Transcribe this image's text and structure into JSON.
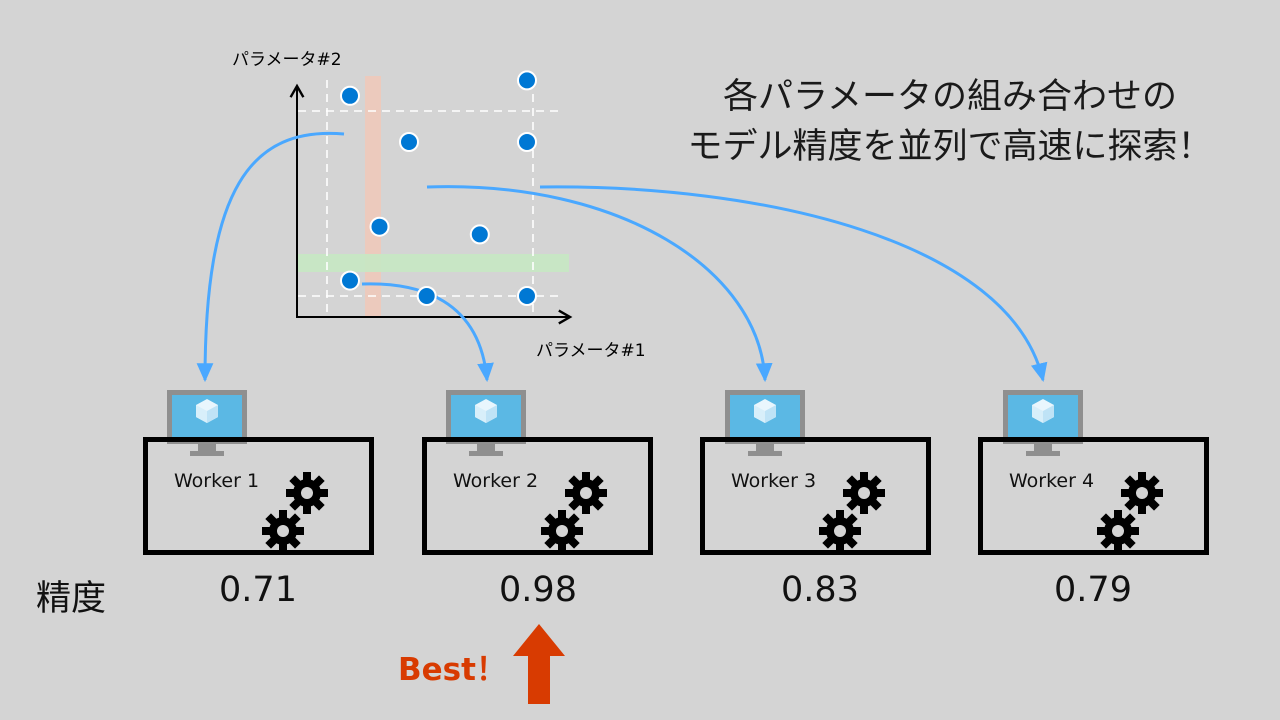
{
  "headline": {
    "line1": "各パラメータの組み合わせの",
    "line2": "モデル精度を並列で高速に探索！"
  },
  "plot": {
    "y_axis_label": "パラメータ#2",
    "x_axis_label": "パラメータ#1",
    "points": [
      {
        "x": 1,
        "y": 5
      },
      {
        "x": 4,
        "y": 5.2
      },
      {
        "x": 2,
        "y": 4.4
      },
      {
        "x": 4,
        "y": 4.4
      },
      {
        "x": 1.5,
        "y": 3.3
      },
      {
        "x": 3.2,
        "y": 3.2
      },
      {
        "x": 1,
        "y": 2.6
      },
      {
        "x": 2.3,
        "y": 2.4
      },
      {
        "x": 4,
        "y": 2.4
      }
    ]
  },
  "workers": [
    {
      "label": "Worker 1",
      "score": "0.71"
    },
    {
      "label": "Worker 2",
      "score": "0.98"
    },
    {
      "label": "Worker 3",
      "score": "0.83"
    },
    {
      "label": "Worker 4",
      "score": "0.79"
    }
  ],
  "metric_label": "精度",
  "best_label": "Best！",
  "colors": {
    "background": "#d4d4d4",
    "point": "#0078d4",
    "connector": "#4aa8ff",
    "highlight_vertical": "#f4c7b6",
    "highlight_horizontal": "#c7e8c3",
    "best": "#d83b01",
    "monitor_screen": "#5bb8e4"
  }
}
